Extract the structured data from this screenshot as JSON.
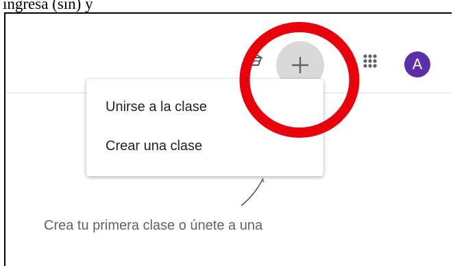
{
  "caption": "ingresa (sin) y",
  "header": {
    "avatar_letter": "A",
    "icons": [
      "cake-icon",
      "plus-icon",
      "apps-grid-icon"
    ]
  },
  "menu": {
    "items": [
      {
        "label": "Unirse a la clase"
      },
      {
        "label": "Crear una clase"
      }
    ]
  },
  "main": {
    "empty_state_text": "Crea tu primera clase o únete a una"
  },
  "colors": {
    "plus_button_bg": "#d9d9d9",
    "avatar_bg": "#5b2fa8",
    "annotation_red": "#e8000b"
  }
}
